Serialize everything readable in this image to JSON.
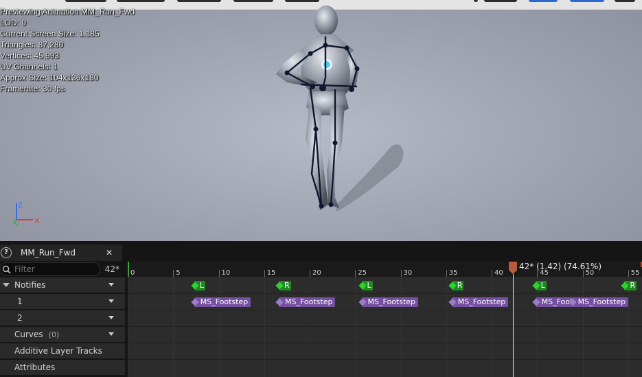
{
  "viewport": {
    "stats": [
      "Previewing Animation MM_Run_Fwd",
      "LOD: 0",
      "Current Screen Size: 1.185",
      "Triangles: 87,280",
      "Vertices: 45,993",
      "UV Channels: 1",
      "Approx Size: 104x136x180",
      "Framerate: 30 fps"
    ],
    "axis": {
      "z": "Z",
      "x": "X",
      "y": "Y"
    }
  },
  "timeline": {
    "tab_title": "MM_Run_Fwd",
    "help_glyph": "?",
    "close_glyph": "✕",
    "filter_placeholder": "Filter",
    "frame_count": "42*",
    "scrub_label": "42* (1.42) (74.61%)",
    "ruler_ticks": [
      "0",
      "5",
      "10",
      "15",
      "20",
      "25",
      "30",
      "35",
      "40",
      "45",
      "50",
      "55"
    ],
    "tracks": {
      "notifies": "Notifies",
      "track1": "1",
      "track2": "2",
      "curves": "Curves",
      "curves_count": "(0)",
      "additive": "Additive Layer Tracks",
      "attributes": "Attributes"
    },
    "lr_notifies": [
      {
        "label": "L",
        "frame": 7
      },
      {
        "label": "R",
        "frame": 16.3
      },
      {
        "label": "L",
        "frame": 25.4
      },
      {
        "label": "R",
        "frame": 35.3
      },
      {
        "label": "L",
        "frame": 44.5
      },
      {
        "label": "R",
        "frame": 54.3
      }
    ],
    "footstep_notifies": [
      {
        "label": "MS_Footstep",
        "frame": 7
      },
      {
        "label": "MS_Footstep",
        "frame": 16.3
      },
      {
        "label": "MS_Footstep",
        "frame": 25.4
      },
      {
        "label": "MS_Footstep",
        "frame": 35.3
      },
      {
        "label": "MS_Footstep",
        "frame": 44.5
      },
      {
        "label": "MS_Footstep",
        "frame": 48.5
      }
    ]
  }
}
